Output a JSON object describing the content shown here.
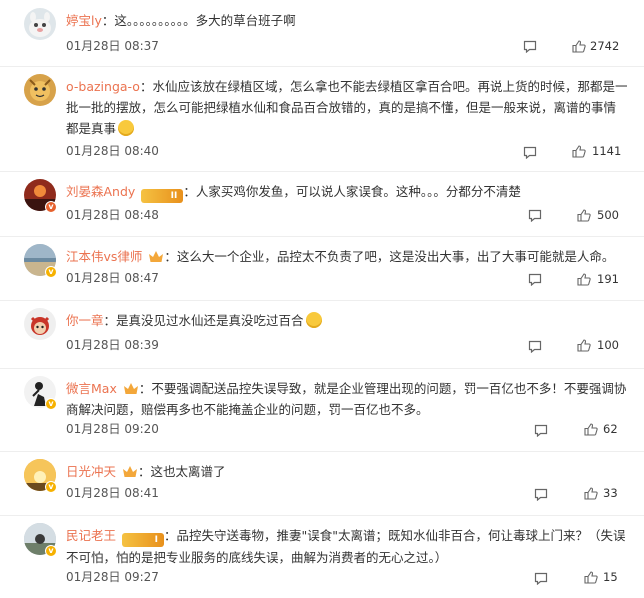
{
  "comments": [
    {
      "username": "婷宝ly",
      "content": "：这。。。。。。。。。。多大的草台班子啊",
      "timestamp": "01月28日 08:37",
      "likes": "2742",
      "badge": "none",
      "emoji": false
    },
    {
      "username": "o-bazinga-o",
      "content": "：水仙应该放在绿植区域，怎么拿也不能去绿植区拿百合吧。再说上货的时候，那都是一批一批的摆放，怎么可能把绿植水仙和食品百合放错的，真的是搞不懂，但是一般来说，离谱的事情都是真事",
      "timestamp": "01月28日 08:40",
      "likes": "1141",
      "badge": "none",
      "emoji": true
    },
    {
      "username": "刘晏森Andy",
      "content": "：人家买鸡你发鱼，可以说人家误食。这种。。。分都分不清楚",
      "timestamp": "01月28日 08:48",
      "likes": "500",
      "badge": "level",
      "level_text": "II",
      "emoji": false
    },
    {
      "username": "江本伟vs律师",
      "content": "：这么大一个企业，品控太不负责了吧，这是没出大事，出了大事可能就是人命。",
      "timestamp": "01月28日 08:47",
      "likes": "191",
      "badge": "crown",
      "emoji": false
    },
    {
      "username": "你一章",
      "content": "：是真没见过水仙还是真没吃过百合",
      "timestamp": "01月28日 08:39",
      "likes": "100",
      "badge": "none",
      "emoji": true
    },
    {
      "username": "微言Max",
      "content": "：不要强调配送品控失误导致，就是企业管理出现的问题，罚一百亿也不多！不要强调协商解决问题，赔偿再多也不能掩盖企业的问题，罚一百亿也不多。",
      "timestamp": "01月28日 09:20",
      "likes": "62",
      "badge": "crown",
      "emoji": false
    },
    {
      "username": "日光冲天",
      "content": "：这也太离谱了",
      "timestamp": "01月28日 08:41",
      "likes": "33",
      "badge": "crown",
      "emoji": false
    },
    {
      "username": "民记老王",
      "content": "：品控失守送毒物，推妻\"误食\"太离谱；既知水仙非百合，何让毒球上门来？（失误不可怕，怕的是把专业服务的底线失误，曲解为消费者的无心之过。）",
      "timestamp": "01月28日 09:27",
      "likes": "15",
      "badge": "level",
      "level_text": "I",
      "emoji": false
    }
  ]
}
